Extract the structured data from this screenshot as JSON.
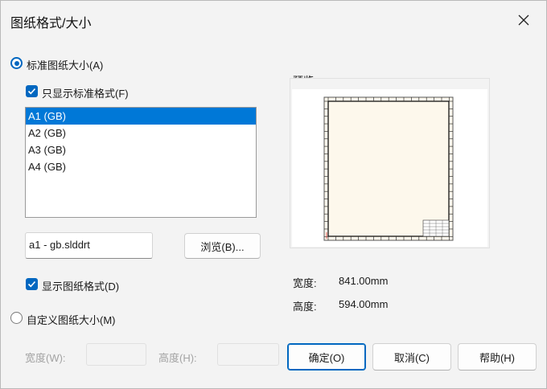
{
  "dialog": {
    "title": "图纸格式/大小",
    "close_icon": "close-icon"
  },
  "standard": {
    "radio_label": "标准图纸大小(A)",
    "selected": true,
    "only_standard_label": "只显示标准格式(F)",
    "only_standard_checked": true,
    "sizes": [
      "A1 (GB)",
      "A2 (GB)",
      "A3 (GB)",
      "A4 (GB)"
    ],
    "selected_size": "A1 (GB)",
    "format_file": "a1 - gb.slddrt",
    "browse_label": "浏览(B)...",
    "show_format_label": "显示图纸格式(D)",
    "show_format_checked": true
  },
  "preview": {
    "label": "预览:",
    "width_label": "宽度:",
    "width_value": "841.00mm",
    "height_label": "高度:",
    "height_value": "594.00mm"
  },
  "custom": {
    "radio_label": "自定义图纸大小(M)",
    "selected": false,
    "width_label": "宽度(W):",
    "height_label": "高度(H):",
    "width_value": "",
    "height_value": ""
  },
  "buttons": {
    "ok": "确定(O)",
    "cancel": "取消(C)",
    "help": "帮助(H)"
  },
  "colors": {
    "accent": "#0067c0",
    "selection": "#0078d7",
    "sheet_fill": "#fdf8ec"
  }
}
